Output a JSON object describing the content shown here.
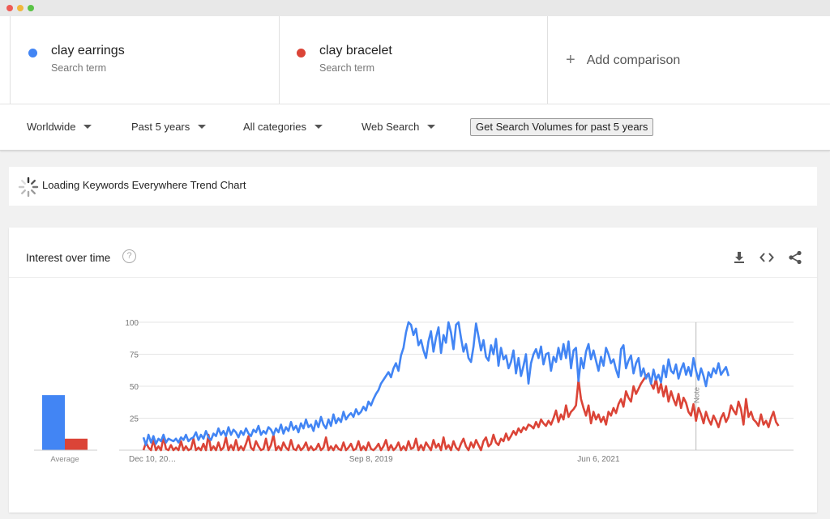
{
  "terms": [
    {
      "name": "clay earrings",
      "sub": "Search term",
      "color": "#4285f4"
    },
    {
      "name": "clay bracelet",
      "sub": "Search term",
      "color": "#db4437"
    }
  ],
  "add_comparison": "Add comparison",
  "filters": {
    "region": "Worldwide",
    "period": "Past 5 years",
    "category": "All categories",
    "search_type": "Web Search",
    "volumes_button": "Get Search Volumes for past 5 years"
  },
  "loading_text": "Loading Keywords Everywhere Trend Chart",
  "card": {
    "title": "Interest over time",
    "help": "?"
  },
  "icons": [
    "download-icon",
    "embed-icon",
    "share-icon",
    "help-icon",
    "loading-spinner-icon"
  ],
  "chart_data": {
    "type": "line",
    "ylim": [
      0,
      100
    ],
    "yticks": [
      100,
      75,
      50,
      25
    ],
    "xtick_labels": [
      "Dec 10, 20…",
      "Sep 8, 2019",
      "Jun 6, 2021"
    ],
    "xtick_weeks": [
      0,
      91,
      182
    ],
    "note_label": "Note",
    "note_week": 221,
    "n_weeks": 261,
    "average": {
      "label": "Average",
      "values": [
        43,
        9
      ]
    },
    "series": [
      {
        "name": "clay earrings",
        "color": "#4285f4",
        "values": [
          10,
          4,
          12,
          6,
          11,
          5,
          9,
          7,
          12,
          6,
          9,
          8,
          7,
          9,
          6,
          10,
          8,
          12,
          7,
          9,
          10,
          14,
          8,
          12,
          9,
          15,
          10,
          8,
          13,
          11,
          17,
          12,
          15,
          11,
          18,
          12,
          16,
          14,
          10,
          15,
          12,
          17,
          13,
          11,
          16,
          14,
          19,
          12,
          15,
          13,
          18,
          16,
          12,
          17,
          14,
          20,
          13,
          18,
          15,
          22,
          16,
          19,
          14,
          21,
          17,
          24,
          18,
          20,
          15,
          23,
          18,
          26,
          20,
          17,
          24,
          19,
          28,
          21,
          25,
          22,
          30,
          24,
          27,
          29,
          26,
          32,
          28,
          30,
          34,
          31,
          38,
          35,
          40,
          44,
          47,
          52,
          55,
          58,
          61,
          57,
          64,
          68,
          62,
          74,
          80,
          92,
          100,
          98,
          90,
          95,
          82,
          86,
          78,
          72,
          85,
          93,
          77,
          88,
          96,
          76,
          90,
          84,
          100,
          92,
          79,
          98,
          100,
          88,
          77,
          83,
          72,
          69,
          81,
          99,
          89,
          78,
          86,
          73,
          70,
          82,
          75,
          87,
          66,
          80,
          71,
          74,
          64,
          69,
          78,
          60,
          72,
          58,
          66,
          75,
          52,
          68,
          75,
          79,
          72,
          81,
          67,
          75,
          76,
          62,
          73,
          69,
          80,
          71,
          83,
          72,
          85,
          64,
          78,
          80,
          54,
          72,
          64,
          77,
          83,
          71,
          78,
          70,
          62,
          73,
          66,
          80,
          75,
          68,
          71,
          63,
          57,
          79,
          82,
          64,
          70,
          74,
          60,
          68,
          72,
          58,
          64,
          56,
          60,
          52,
          63,
          55,
          59,
          53,
          66,
          57,
          71,
          62,
          60,
          67,
          56,
          63,
          68,
          59,
          65,
          58,
          72,
          62,
          55,
          64,
          58,
          50,
          61,
          57,
          64,
          60,
          68,
          59,
          62,
          65,
          58
        ],
        "comment": "weekly index values"
      },
      {
        "name": "clay bracelet",
        "color": "#db4437",
        "values": [
          0,
          6,
          2,
          0,
          8,
          0,
          3,
          0,
          10,
          1,
          0,
          4,
          0,
          2,
          0,
          7,
          0,
          3,
          0,
          1,
          9,
          0,
          2,
          0,
          5,
          0,
          12,
          0,
          3,
          0,
          6,
          0,
          2,
          10,
          0,
          4,
          0,
          8,
          0,
          3,
          0,
          5,
          11,
          2,
          0,
          7,
          3,
          0,
          1,
          9,
          0,
          4,
          12,
          0,
          3,
          0,
          6,
          2,
          0,
          8,
          1,
          0,
          4,
          0,
          2,
          6,
          0,
          3,
          0,
          1,
          5,
          0,
          2,
          10,
          0,
          3,
          0,
          4,
          1,
          0,
          6,
          0,
          2,
          5,
          0,
          1,
          7,
          0,
          3,
          0,
          6,
          1,
          0,
          2,
          5,
          0,
          3,
          8,
          0,
          4,
          0,
          2,
          6,
          0,
          3,
          0,
          7,
          1,
          2,
          9,
          0,
          4,
          0,
          6,
          3,
          0,
          8,
          2,
          5,
          0,
          10,
          1,
          4,
          0,
          7,
          2,
          0,
          5,
          9,
          3,
          0,
          6,
          2,
          8,
          4,
          0,
          7,
          10,
          3,
          5,
          12,
          6,
          4,
          9,
          7,
          13,
          8,
          11,
          15,
          12,
          17,
          14,
          18,
          16,
          20,
          19,
          17,
          22,
          18,
          24,
          21,
          19,
          23,
          20,
          25,
          31,
          22,
          28,
          24,
          35,
          26,
          30,
          32,
          35,
          55,
          40,
          33,
          27,
          35,
          21,
          30,
          24,
          28,
          22,
          26,
          20,
          30,
          27,
          33,
          29,
          36,
          40,
          34,
          46,
          41,
          38,
          50,
          44,
          48,
          52,
          55,
          58,
          60,
          52,
          48,
          56,
          45,
          52,
          42,
          50,
          38,
          46,
          40,
          35,
          44,
          33,
          41,
          37,
          30,
          27,
          36,
          23,
          33,
          28,
          21,
          30,
          24,
          20,
          27,
          23,
          18,
          25,
          29,
          22,
          26,
          35,
          31,
          28,
          38,
          32,
          20,
          40,
          26,
          30,
          24,
          22,
          19,
          28,
          20,
          23,
          18,
          25,
          30,
          22,
          19
        ],
        "comment": "weekly index values"
      }
    ]
  }
}
